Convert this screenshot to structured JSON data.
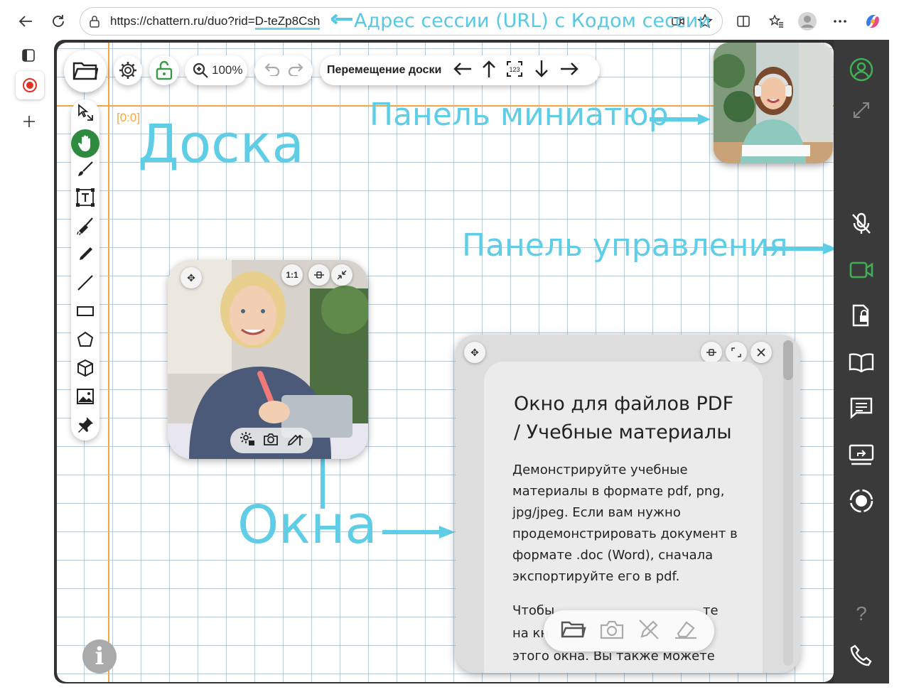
{
  "browser": {
    "url_prefix": "https://chattern.ru/duo?rid=",
    "url_rid": "D-teZp8Csh",
    "annotation_url": "Адрес сессии (URL) с Кодом сессии"
  },
  "toolbar": {
    "zoom": "100%",
    "move_board_label": "Перемещение доски"
  },
  "board": {
    "coord": "[0:0]",
    "title": "Доска"
  },
  "annotations": {
    "thumbnails": "Панель миниатюр",
    "control_panel": "Панель управления",
    "windows": "Окна"
  },
  "window_controls": {
    "ratio": "1:1"
  },
  "pdf": {
    "heading": "Окно для файлов PDF / Учебные материалы",
    "paragraph1": "Демонстрируйте учебные материалы в формате pdf, png, jpg/jpeg. Если вам нужно продемонстрировать документ в формате .doc (Word), сначала экспортируйте его в pdf.",
    "para2_line1": "Чтобы",
    "para2_line1_end": "те",
    "para2_line2": "на кн",
    "para2_line3": "этого окна. Вы также можете"
  },
  "colors": {
    "accent": "#5fcde6",
    "green": "#3a9a4a",
    "orange": "#f0a845"
  }
}
